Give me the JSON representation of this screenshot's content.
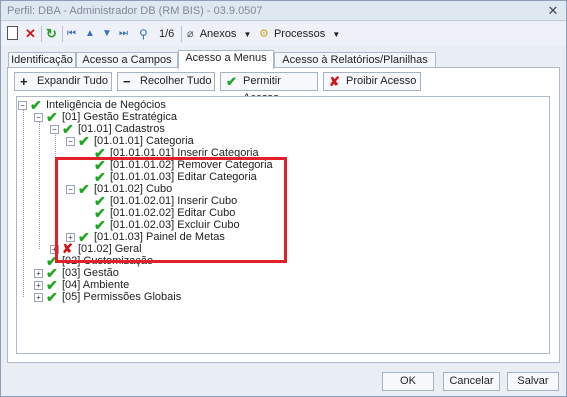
{
  "window": {
    "title": "Perfil: DBA - Administrador DB (RM BIS) - 03.9.0507",
    "close_label": "✕"
  },
  "toolbar": {
    "record_counter": "1/6",
    "anexos_label": "Anexos",
    "processos_label": "Processos"
  },
  "tabs": [
    {
      "label": "Identificação"
    },
    {
      "label": "Acesso a Campos"
    },
    {
      "label": "Acesso a Menus"
    },
    {
      "label": "Acesso à Relatórios/Planilhas"
    }
  ],
  "actions": {
    "expandir": "Expandir Tudo",
    "recolher": "Recolher Tudo",
    "permitir": "Permitir Acesso",
    "proibir": "Proibir Acesso"
  },
  "tree": {
    "root": "Inteligência de Negócios",
    "gestao_estrategica": "[01] Gestão Estratégica",
    "cadastros": "[01.01] Cadastros",
    "categoria": "[01.01.01] Categoria",
    "inserir_categoria": "[01.01.01.01] Inserir Categoria",
    "remover_categoria": "[01.01.01.02] Remover Categoria",
    "editar_categoria": "[01.01.01.03] Editar Categoria",
    "cubo": "[01.01.02] Cubo",
    "inserir_cubo": "[01.01.02.01] Inserir Cubo",
    "editar_cubo": "[01.01.02.02] Editar Cubo",
    "excluir_cubo": "[01.01.02.03] Excluir Cubo",
    "painel_metas": "[01.01.03] Painel de Metas",
    "geral": "[01.02] Geral",
    "customizacao": "[02] Customização",
    "gestao": "[03] Gestão",
    "ambiente": "[04] Ambiente",
    "permissoes": "[05] Permissões Globais"
  },
  "footer": {
    "ok": "OK",
    "cancelar": "Cancelar",
    "salvar": "Salvar"
  }
}
